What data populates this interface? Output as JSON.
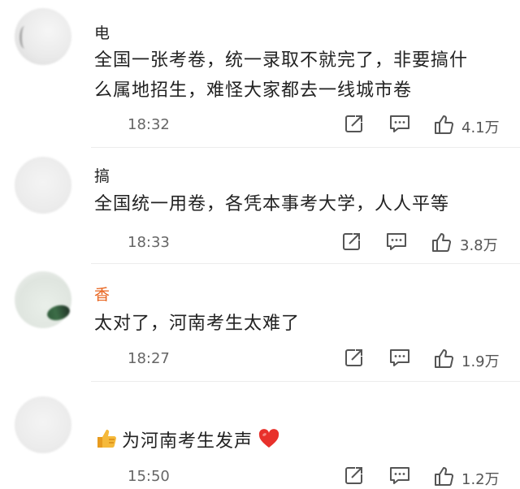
{
  "comments": [
    {
      "name": "电",
      "text_line1": "全国一张考卷，统一录取不就完了，非要搞什",
      "text_line2": "么属地招生，难怪大家都去一线城市卷",
      "time": "18:32",
      "likes": "4.1万"
    },
    {
      "name": "搞",
      "text_line1": "全国统一用卷，各凭本事考大学，人人平等",
      "time": "18:33",
      "likes": "3.8万"
    },
    {
      "name": "香",
      "text_line1": "太对了，河南考生太难了",
      "time": "18:27",
      "likes": "1.9万"
    },
    {
      "name": "",
      "text_line1": "为河南考生发声",
      "time": "15:50",
      "likes": "1.2万"
    }
  ],
  "icons": {
    "share": "share-icon",
    "comment": "comment-icon",
    "like": "thumbs-up-icon"
  },
  "colors": {
    "name_highlight": "#e8641e",
    "heart": "#e8312b",
    "thumb": "#f5b93a"
  }
}
